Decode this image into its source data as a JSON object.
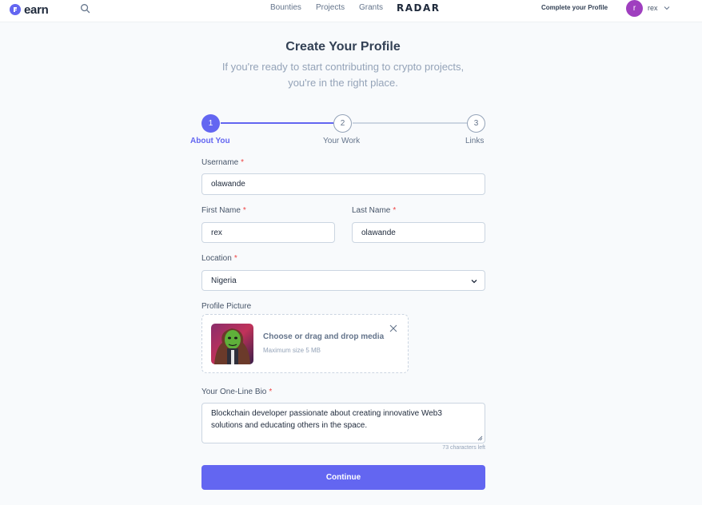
{
  "header": {
    "logo_text": "earn",
    "nav": [
      "Bounties",
      "Projects",
      "Grants"
    ],
    "radar_label": "RADAR",
    "complete_profile_label": "Complete your Profile",
    "user": {
      "initial": "r",
      "name": "rex"
    }
  },
  "page": {
    "title": "Create Your Profile",
    "subtitle_line1": "If you're ready to start contributing to crypto projects,",
    "subtitle_line2": "you're in the right place."
  },
  "stepper": {
    "steps": [
      {
        "number": "1",
        "label": "About You",
        "state": "active"
      },
      {
        "number": "2",
        "label": "Your Work",
        "state": "inactive"
      },
      {
        "number": "3",
        "label": "Links",
        "state": "inactive"
      }
    ]
  },
  "form": {
    "required_marker": "*",
    "username": {
      "label": "Username",
      "value": "olawande"
    },
    "first_name": {
      "label": "First Name",
      "value": "rex"
    },
    "last_name": {
      "label": "Last Name",
      "value": "olawande"
    },
    "location": {
      "label": "Location",
      "value": "Nigeria"
    },
    "profile_picture": {
      "label": "Profile Picture",
      "upload_title": "Choose or drag and drop media",
      "upload_hint": "Maximum size 5 MB"
    },
    "bio": {
      "label": "Your One-Line Bio",
      "value": "Blockchain developer passionate about creating innovative Web3 solutions and educating others in the space.",
      "char_count": "73 characters left"
    },
    "continue_label": "Continue"
  },
  "colors": {
    "accent": "#6366f1",
    "required": "#ef4444",
    "avatar": "#9f3fbf"
  }
}
